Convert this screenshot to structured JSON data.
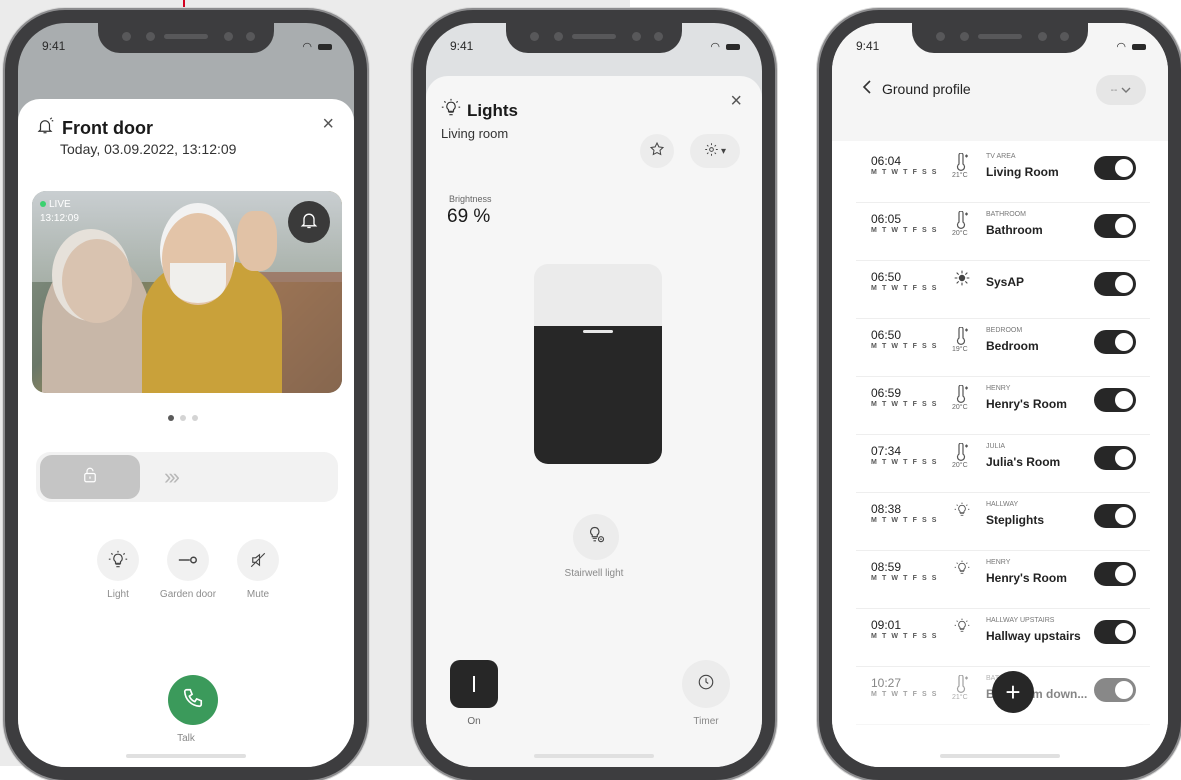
{
  "status_time": "9:41",
  "door": {
    "title": "Front door",
    "subtitle": "Today, 03.09.2022, 13:12:09",
    "live_label": "LIVE",
    "live_time": "13:12:09",
    "slider_arrows": "›››",
    "actions": [
      {
        "label": "Light",
        "icon": "lightbulb-icon"
      },
      {
        "label": "Garden door",
        "icon": "door-key-icon"
      },
      {
        "label": "Mute",
        "icon": "mute-icon"
      }
    ],
    "talk_label": "Talk"
  },
  "lights": {
    "title": "Lights",
    "subtitle": "Living room",
    "brightness_label": "Brightness",
    "brightness_value": "69 %",
    "brightness_level": 0.69,
    "stairwell_label": "Stairwell light",
    "on_label": "On",
    "timer_label": "Timer"
  },
  "schedule": {
    "title": "Ground profile",
    "dropdown_value": "--",
    "days": "M T W T F S S",
    "rows": [
      {
        "time": "06:04",
        "icon": "thermometer-icon",
        "temp": "21°C",
        "area": "TV AREA",
        "name": "Living Room",
        "on": true
      },
      {
        "time": "06:05",
        "icon": "thermometer-icon",
        "temp": "20°C",
        "area": "BATHROOM",
        "name": "Bathroom",
        "on": true
      },
      {
        "time": "06:50",
        "icon": "sun-icon",
        "temp": "",
        "area": "",
        "name": "SysAP",
        "on": true
      },
      {
        "time": "06:50",
        "icon": "thermometer-icon",
        "temp": "19°C",
        "area": "BEDROOM",
        "name": "Bedroom",
        "on": true
      },
      {
        "time": "06:59",
        "icon": "thermometer-icon",
        "temp": "20°C",
        "area": "HENRY",
        "name": "Henry's Room",
        "on": true
      },
      {
        "time": "07:34",
        "icon": "thermometer-icon",
        "temp": "20°C",
        "area": "JULIA",
        "name": "Julia's Room",
        "on": true
      },
      {
        "time": "08:38",
        "icon": "lightbulb-icon",
        "temp": "",
        "area": "HALLWAY",
        "name": "Steplights",
        "on": true
      },
      {
        "time": "08:59",
        "icon": "lightbulb-icon",
        "temp": "",
        "area": "HENRY",
        "name": "Henry's Room",
        "on": true
      },
      {
        "time": "09:01",
        "icon": "lightbulb-icon",
        "temp": "",
        "area": "HALLWAY UPSTAIRS",
        "name": "Hallway upstairs",
        "on": true
      },
      {
        "time": "10:27",
        "icon": "thermometer-icon",
        "temp": "21°C",
        "area": "BATHROOM",
        "name": "Bathroom down...",
        "on": true
      }
    ],
    "fab_label": "+"
  }
}
